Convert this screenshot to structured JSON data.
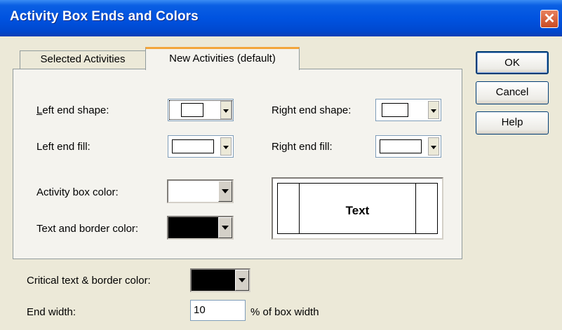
{
  "window": {
    "title": "Activity Box Ends and Colors",
    "close_glyph": "✕"
  },
  "tabs": {
    "selected": "Selected Activities",
    "new": "New Activities (default)"
  },
  "fields": {
    "left_end_shape": "Left end shape:",
    "left_end_fill": "Left end fill:",
    "right_end_shape": "Right end shape:",
    "right_end_fill": "Right end fill:",
    "activity_box_color": "Activity box color:",
    "text_border_color": "Text and border color:",
    "critical_color": "Critical text & border color:",
    "end_width": "End width:",
    "end_width_value": "10",
    "end_width_suffix": "% of box width"
  },
  "colors": {
    "activity_box": "#ffffff",
    "text_border": "#000000",
    "critical": "#000000"
  },
  "preview": {
    "text": "Text"
  },
  "buttons": {
    "ok": "OK",
    "cancel": "Cancel",
    "help": "Help"
  }
}
